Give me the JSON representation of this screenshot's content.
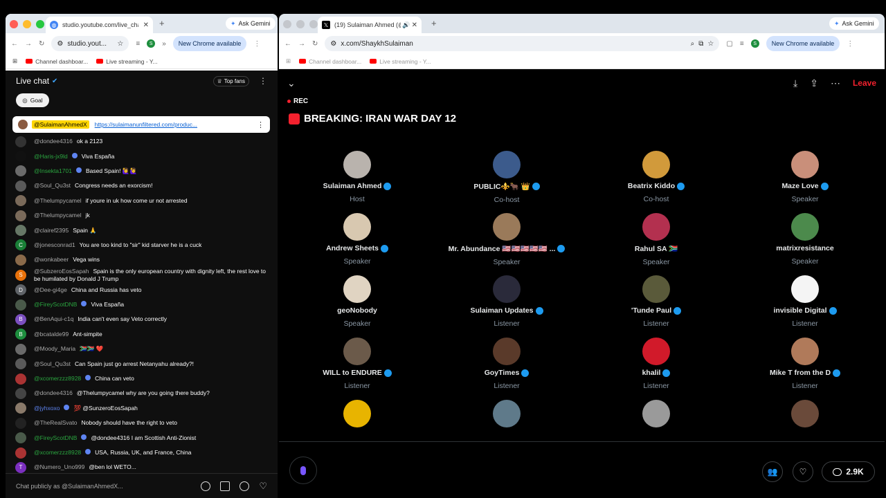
{
  "left_window": {
    "tab_title": "studio.youtube.com/live_cha",
    "ask_gemini": "Ask Gemini",
    "url": "studio.yout...",
    "new_chrome": "New Chrome available",
    "bookmarks": [
      "Channel dashboar...",
      "Live streaming - Y..."
    ],
    "profile_initial": "S"
  },
  "chat": {
    "title": "Live chat",
    "top_fans": "Top fans",
    "goal": "Goal",
    "pinned": {
      "user": "@SulaimanAhmedX",
      "link": "https://sulaimanunfiltered.com/produc..."
    },
    "messages": [
      {
        "user": "@dondee4316",
        "text": "ok a 2123",
        "style": "normal",
        "avatar_color": "#333333",
        "initial": ""
      },
      {
        "user": "@Haris-jx9ld",
        "text": "Viva España",
        "style": "member",
        "avatar_color": "#111111",
        "initial": "",
        "badge": true
      },
      {
        "user": "@Insekta1701",
        "text": "Based Spain! 🙋‍♀️🙋‍♀️",
        "style": "member",
        "avatar_color": "#6b6b6b",
        "initial": "",
        "badge": true
      },
      {
        "user": "@Soul_Qu3st",
        "text": "Congress needs an exorcism!",
        "style": "normal",
        "avatar_color": "#5a5a5a",
        "initial": ""
      },
      {
        "user": "@Thelumpycamel",
        "text": "if youre in uk how come ur not arrested",
        "style": "normal",
        "avatar_color": "#7a6a5a",
        "initial": ""
      },
      {
        "user": "@Thelumpycamel",
        "text": "jk",
        "style": "normal",
        "avatar_color": "#7a6a5a",
        "initial": ""
      },
      {
        "user": "@clairef2395",
        "text": "Spain 🙏",
        "style": "normal",
        "avatar_color": "#667766",
        "initial": ""
      },
      {
        "user": "@jonesconrad1",
        "text": "You are too kind to \"sir\" kid starver he is a cuck",
        "style": "normal",
        "avatar_color": "#1a7f37",
        "initial": "C"
      },
      {
        "user": "@wonkabeer",
        "text": "Vega wins",
        "style": "normal",
        "avatar_color": "#8a6a4a",
        "initial": ""
      },
      {
        "user": "@SubzeroEosSapah",
        "text": "Spain is the only european country with dignity left, the rest love to be humilated by Donald J Trump",
        "style": "normal",
        "avatar_color": "#e8710a",
        "initial": "S"
      },
      {
        "user": "@Dee-gi4ge",
        "text": "China and Russia has veto",
        "style": "normal",
        "avatar_color": "#5f6368",
        "initial": "D"
      },
      {
        "user": "@FireyScotDNB",
        "text": "Viva España",
        "style": "member",
        "avatar_color": "#4a5a4a",
        "initial": "",
        "badge": true
      },
      {
        "user": "@BenAqui-c1q",
        "text": "India can't even say Veto correctly",
        "style": "normal",
        "avatar_color": "#7b4fbf",
        "initial": "B"
      },
      {
        "user": "@bcatalde99",
        "text": "Ant-simpite",
        "style": "normal",
        "avatar_color": "#1e8e3e",
        "initial": "B"
      },
      {
        "user": "@Moody_Maria",
        "text": "🇿🇦🇿🇦 ❤️",
        "style": "normal",
        "avatar_color": "#6a6a6a",
        "initial": ""
      },
      {
        "user": "@Soul_Qu3st",
        "text": "Can Spain just go arrest Netanyahu already?!",
        "style": "normal",
        "avatar_color": "#5a5a5a",
        "initial": ""
      },
      {
        "user": "@xcomerzzz8928",
        "text": "China can veto",
        "style": "member",
        "avatar_color": "#a33",
        "initial": "",
        "badge": true
      },
      {
        "user": "@dondee4316",
        "text": "@Thelumpycamel why are you going there buddy?",
        "style": "normal",
        "avatar_color": "#444444",
        "initial": ""
      },
      {
        "user": "@jyhxoxo",
        "text": "💯 @SunzeroEosSapah",
        "style": "mod",
        "avatar_color": "#8a7a6a",
        "initial": "",
        "badge": true
      },
      {
        "user": "@TheRealSvato",
        "text": "Nobody should have the right to veto",
        "style": "normal",
        "avatar_color": "#222222",
        "initial": ""
      },
      {
        "user": "@FireyScotDNB",
        "text": "@dondee4316 I am Scottish Anti-Zionist",
        "style": "member",
        "avatar_color": "#4a5a4a",
        "initial": "",
        "badge": true
      },
      {
        "user": "@xcomerzzz8928",
        "text": "USA, Russia, UK, and France, China",
        "style": "member",
        "avatar_color": "#a33",
        "initial": "",
        "badge": true
      },
      {
        "user": "@Numero_Uno999",
        "text": "@ben lol WETO...",
        "style": "normal",
        "avatar_color": "#7b2fbf",
        "initial": "T"
      }
    ],
    "input_placeholder": "Chat publicly as @SulaimanAhmedX..."
  },
  "right_window": {
    "tab_title": "(19) Sulaiman Ahmed (@S",
    "ask_gemini": "Ask Gemini",
    "url": "x.com/ShaykhSulaiman",
    "new_chrome": "New Chrome available",
    "bookmarks": [
      "Channel dashboar...",
      "Live streaming - Y..."
    ],
    "profile_initial": "S"
  },
  "space": {
    "leave": "Leave",
    "rec": "REC",
    "title": "BREAKING: IRAN WAR DAY 12",
    "participants": [
      {
        "name": "Sulaiman Ahmed",
        "role": "Host",
        "verified": true,
        "avatar_color": "#b9b3ad"
      },
      {
        "name": "PUBLIC⚜️🐂 👑",
        "role": "Co-host",
        "verified": true,
        "avatar_color": "#3c5b8c"
      },
      {
        "name": "Beatrix Kiddo",
        "role": "Co-host",
        "verified": true,
        "avatar_color": "#d19a3b"
      },
      {
        "name": "Maze Love",
        "role": "Speaker",
        "verified": true,
        "avatar_color": "#c98f7a"
      },
      {
        "name": "Andrew Sheets",
        "role": "Speaker",
        "verified": true,
        "avatar_color": "#d8c8b0"
      },
      {
        "name": "Mr. Abundance 🇺🇸🇺🇸🇺🇸🇺🇸🇺🇸 ...",
        "role": "Speaker",
        "verified": true,
        "avatar_color": "#9a7a5a"
      },
      {
        "name": "Rahul SA 🇿🇦",
        "role": "Speaker",
        "verified": false,
        "avatar_color": "#b3304f"
      },
      {
        "name": "matrixresistance",
        "role": "Speaker",
        "verified": false,
        "avatar_color": "#4c8a4c"
      },
      {
        "name": "geoNobody",
        "role": "Speaker",
        "verified": false,
        "avatar_color": "#e0d4c2"
      },
      {
        "name": "Sulaiman Updates",
        "role": "Listener",
        "verified": true,
        "avatar_color": "#2a2a3a"
      },
      {
        "name": "'Tunde Paul",
        "role": "Listener",
        "verified": true,
        "avatar_color": "#5a5a3a"
      },
      {
        "name": "invisible Digital",
        "role": "Listener",
        "verified": true,
        "avatar_color": "#f4f4f4"
      },
      {
        "name": "WILL to ENDURE",
        "role": "Listener",
        "verified": true,
        "avatar_color": "#6b5a4a"
      },
      {
        "name": "GoyTimes",
        "role": "Listener",
        "verified": true,
        "avatar_color": "#5a3a2a"
      },
      {
        "name": "khalil",
        "role": "Listener",
        "verified": true,
        "avatar_color": "#d11a2a"
      },
      {
        "name": "Mike T from the D",
        "role": "Listener",
        "verified": true,
        "avatar_color": "#b07a5a"
      },
      {
        "name": "",
        "role": "",
        "verified": false,
        "avatar_color": "#e8b400"
      },
      {
        "name": "",
        "role": "",
        "verified": false,
        "avatar_color": "#5f7a8a"
      },
      {
        "name": "",
        "role": "",
        "verified": false,
        "avatar_color": "#9a9a9a"
      },
      {
        "name": "",
        "role": "",
        "verified": false,
        "avatar_color": "#6a4a3a"
      }
    ],
    "reply_count": "2.9K"
  }
}
